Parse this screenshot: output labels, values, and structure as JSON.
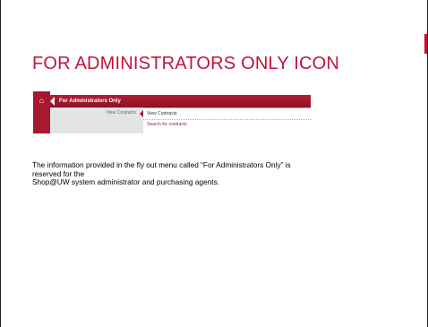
{
  "slide": {
    "title": "FOR ADMINISTRATORS ONLY ICON",
    "accent_color": "#c8102e",
    "body_lines": [
      "The information provided in the fly out menu called “For Administrators Only” is",
      "reserved for the",
      "Shop@UW system administrator and purchasing agents."
    ]
  },
  "screenshot": {
    "header_label": "For Administrators Only",
    "home_icon": "home-icon",
    "left_label": "View Contracts",
    "menu_items": [
      "View Contracts",
      "Search for contracts"
    ]
  }
}
